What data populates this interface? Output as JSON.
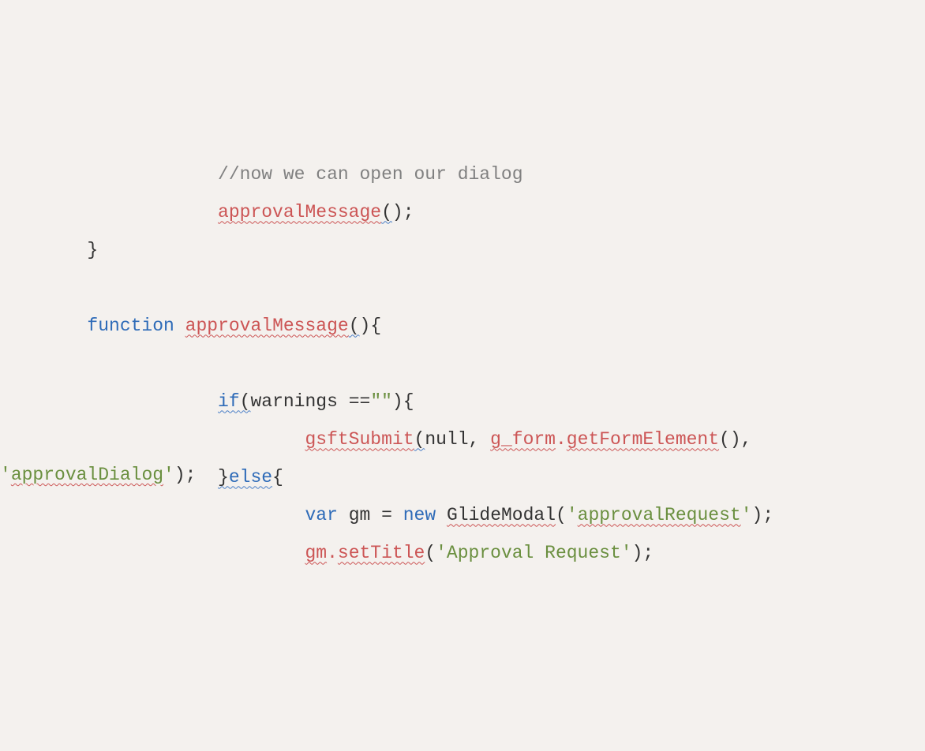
{
  "code": {
    "comment1": "//now we can open our dialog",
    "fn_approvalMessage": "approvalMessage",
    "paren_open": "(",
    "paren_close": ")",
    "semicolon": ";",
    "brace_close": "}",
    "brace_open": "{",
    "kw_function": "function",
    "kw_if": "if",
    "kw_else": "else",
    "kw_var": "var",
    "kw_new": "new",
    "id_warnings": "warnings",
    "op_eq": "==",
    "str_empty": "\"\"",
    "fn_gsftSubmit": "gsftSubmit",
    "null_val": "null",
    "comma": ",",
    "id_gform": "g_form",
    "dot": ".",
    "fn_getFormElement": "getFormElement",
    "str_approvalDialog_q1": "'",
    "str_approvalDialog": "approvalDialog",
    "str_approvalDialog_q2": "'",
    "id_gm": "gm",
    "eq": "=",
    "cls_GlideModal": "GlideModal",
    "str_approvalRequest_q1": "'",
    "str_approvalRequest": "approvalRequest",
    "str_approvalRequest_q2": "'",
    "fn_setTitle": "setTitle",
    "str_ApprovalRequestTitle": "'Approval Request'",
    "space": " "
  }
}
